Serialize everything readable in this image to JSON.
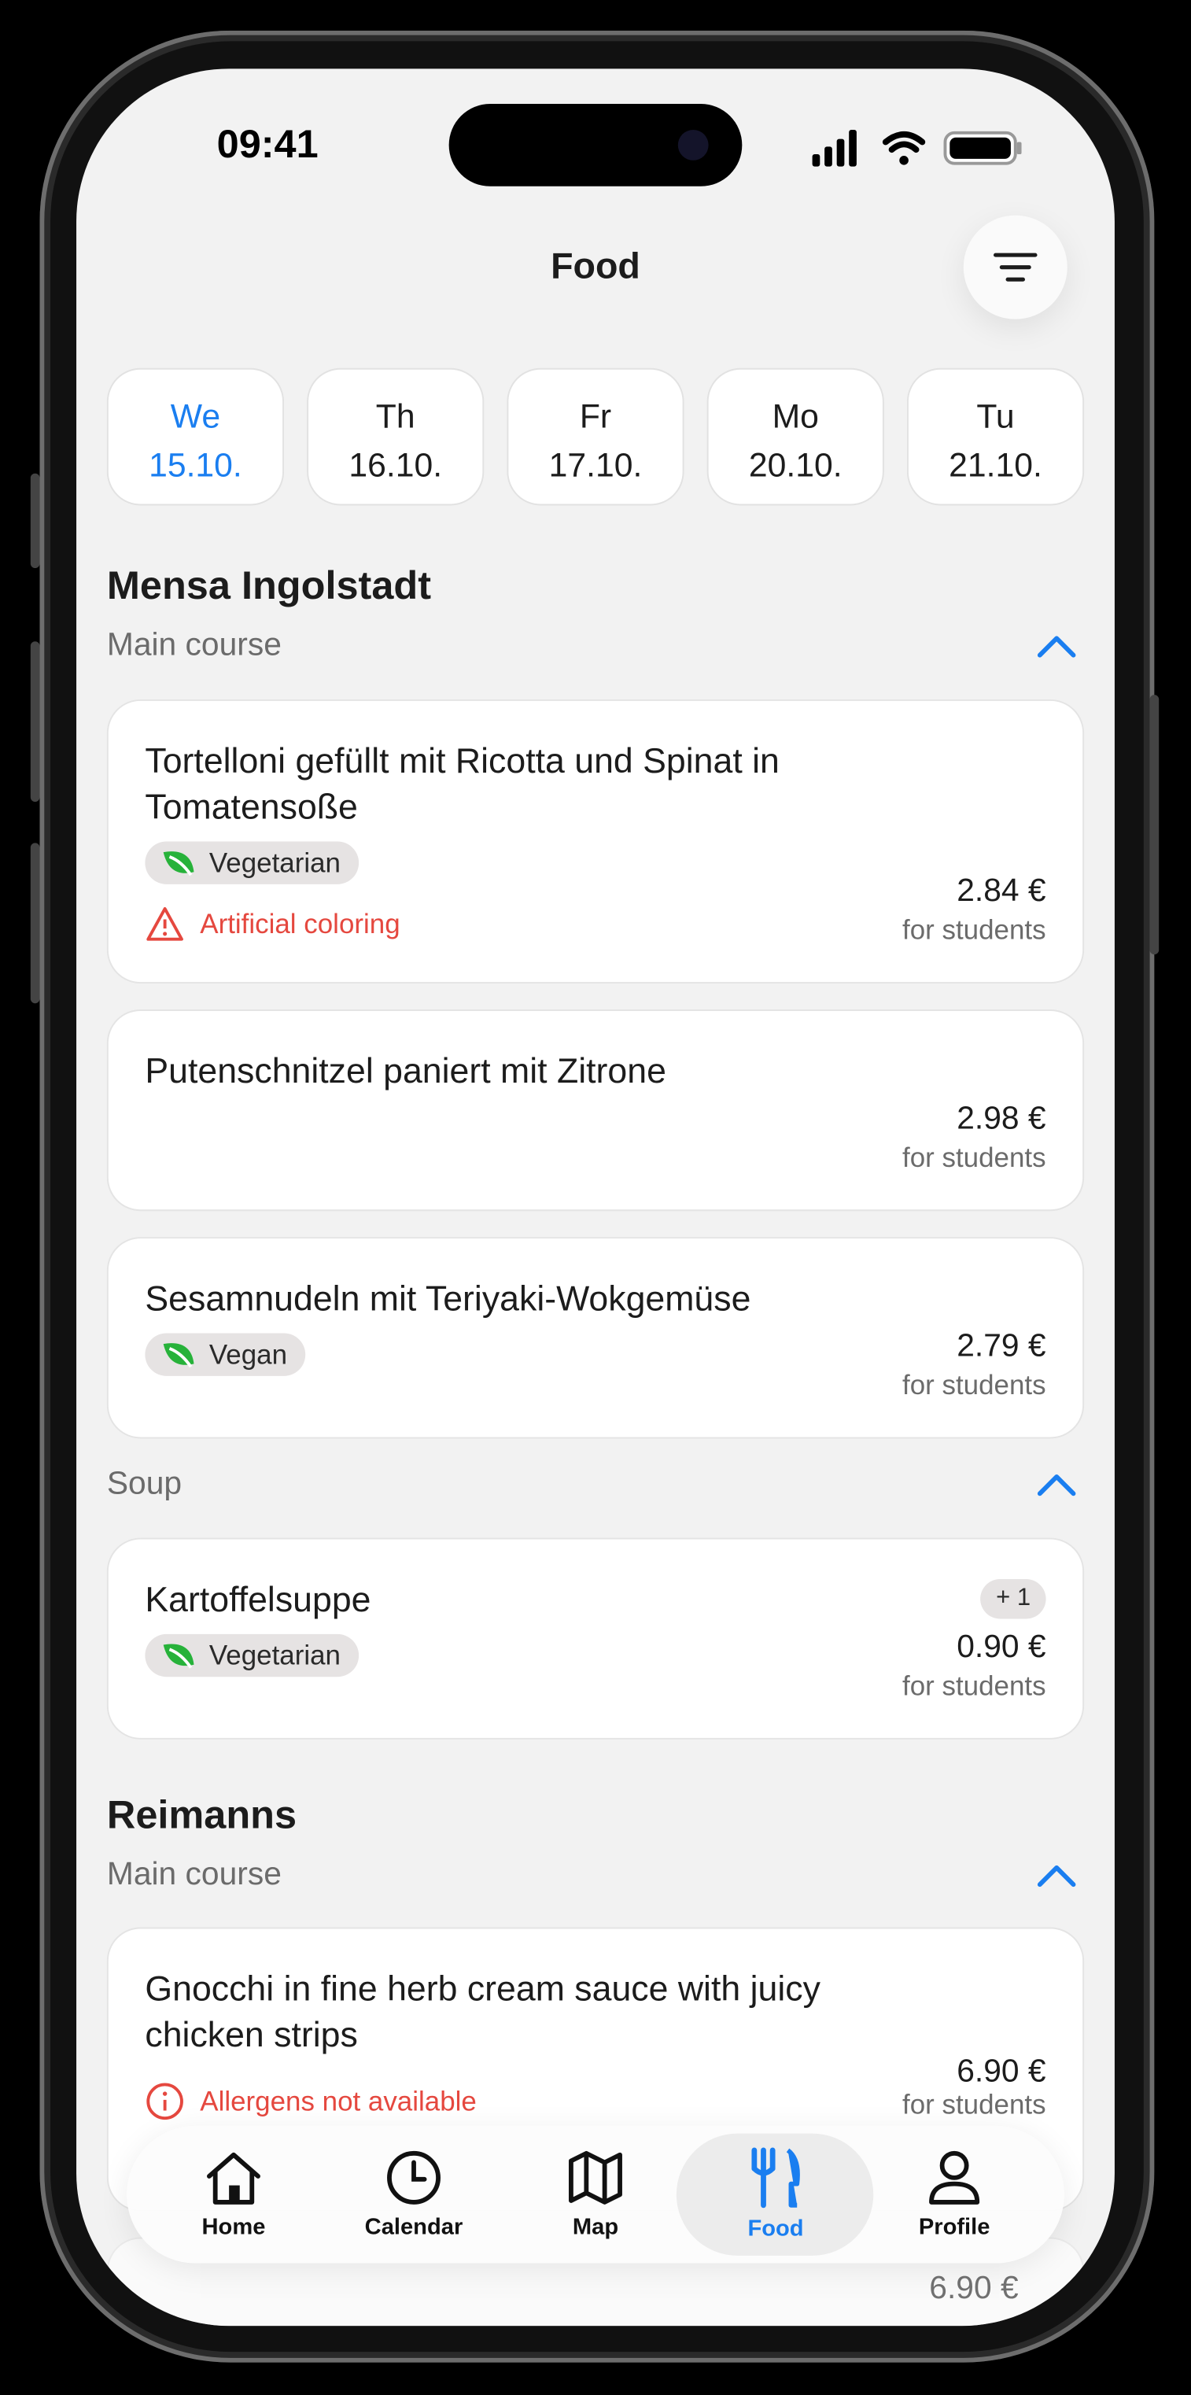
{
  "status_bar": {
    "time": "09:41"
  },
  "header": {
    "title": "Food",
    "filter_icon": "filter-lines-icon"
  },
  "days": [
    {
      "day": "We",
      "date": "15.10.",
      "selected": true
    },
    {
      "day": "Th",
      "date": "16.10."
    },
    {
      "day": "Fr",
      "date": "17.10."
    },
    {
      "day": "Mo",
      "date": "20.10."
    },
    {
      "day": "Tu",
      "date": "21.10."
    }
  ],
  "restaurants": [
    {
      "name": "Mensa Ingolstadt",
      "categories": [
        {
          "name": "Main course",
          "meals": [
            {
              "title": "Tortelloni gefüllt mit Ricotta und Spinat in Tomatensoße",
              "tag": "Vegetarian",
              "warning": "Artificial coloring",
              "price": "2.84 €",
              "price_note": "for students"
            },
            {
              "title": "Putenschnitzel paniert mit Zitrone",
              "price": "2.98 €",
              "price_note": "for students"
            },
            {
              "title": "Sesamnudeln mit Teriyaki-Wokgemüse",
              "tag": "Vegan",
              "price": "2.79 €",
              "price_note": "for students"
            }
          ]
        },
        {
          "name": "Soup",
          "meals": [
            {
              "title": "Kartoffelsuppe",
              "tag": "Vegetarian",
              "badge": "+ 1",
              "price": "0.90 €",
              "price_note": "for students"
            }
          ]
        }
      ]
    },
    {
      "name": "Reimanns",
      "categories": [
        {
          "name": "Main course",
          "meals": [
            {
              "title": "Gnocchi in fine herb cream sauce with juicy chicken strips",
              "warning": "Allergens not available",
              "price": "6.90 €",
              "price_note": "for students"
            },
            {
              "price": "6.90 €"
            }
          ]
        }
      ]
    }
  ],
  "tabbar": [
    {
      "label": "Home",
      "icon": "home-icon"
    },
    {
      "label": "Calendar",
      "icon": "clock-icon"
    },
    {
      "label": "Map",
      "icon": "map-icon"
    },
    {
      "label": "Food",
      "icon": "fork-knife-icon",
      "active": true
    },
    {
      "label": "Profile",
      "icon": "person-icon"
    }
  ],
  "colors": {
    "accent": "#1a7ef0",
    "warning": "#e5483f",
    "leaf": "#27b23a",
    "background": "#f2f2f2"
  }
}
